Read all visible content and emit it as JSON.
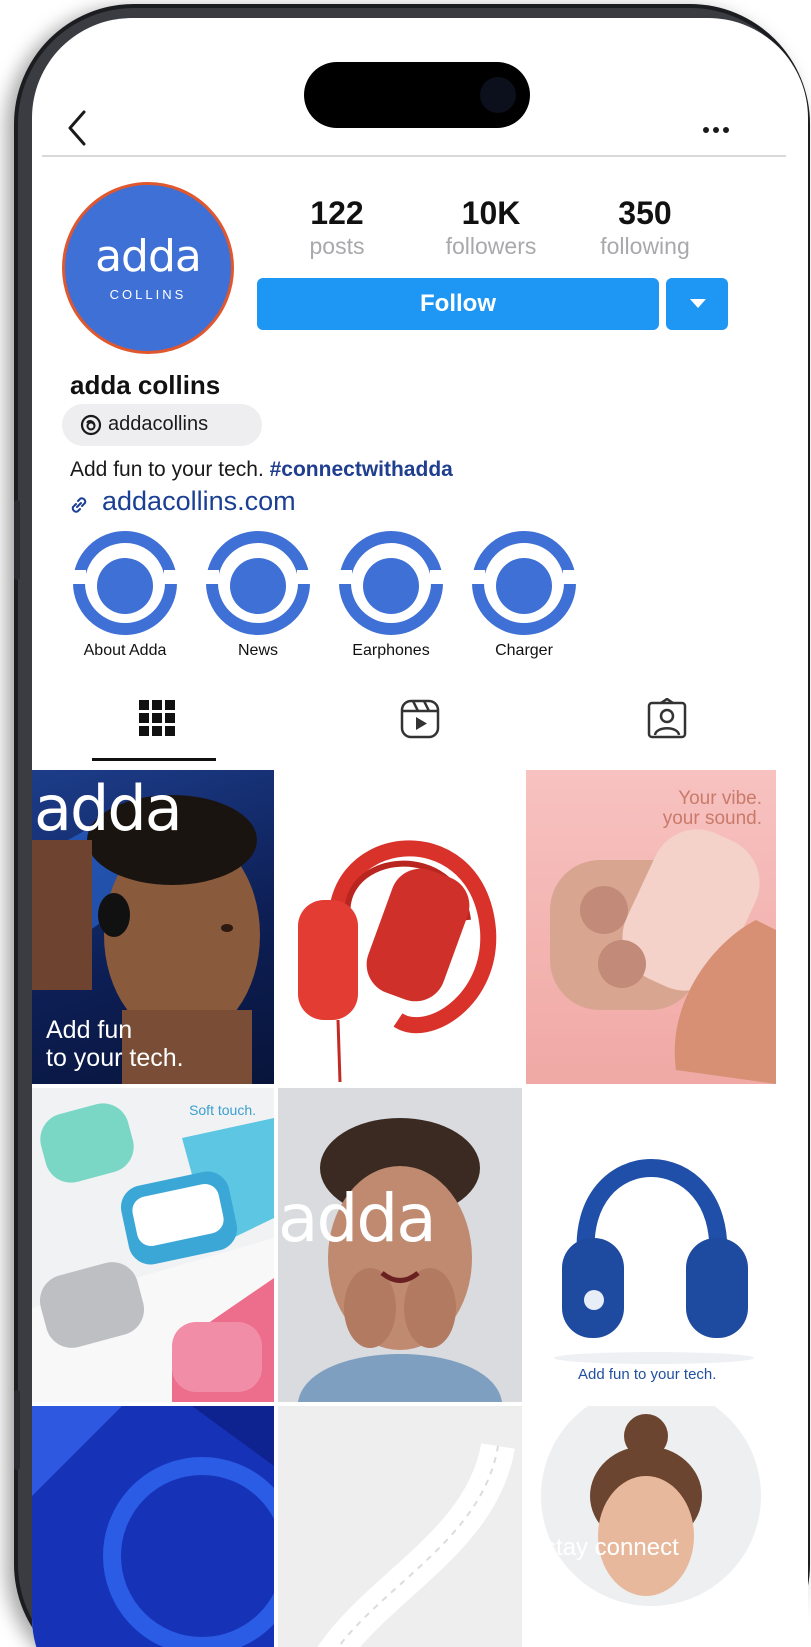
{
  "profile": {
    "posts": {
      "count": "122",
      "label": "posts"
    },
    "followers": {
      "count": "10K",
      "label": "followers"
    },
    "following": {
      "count": "350",
      "label": "following"
    },
    "follow_label": "Follow",
    "name": "adda collins",
    "threads_handle": "addacollins",
    "bio_text": "Add fun to your tech. ",
    "bio_hashtag": "#connectwithadda",
    "website": "addacollins.com",
    "avatar_logo": "adda",
    "avatar_sub": "COLLINS"
  },
  "highlights": [
    {
      "label": "About Adda"
    },
    {
      "label": "News"
    },
    {
      "label": "Earphones"
    },
    {
      "label": "Charger"
    }
  ],
  "tabs": [
    {
      "icon": "grid-icon",
      "selected": true
    },
    {
      "icon": "reels-icon",
      "selected": false
    },
    {
      "icon": "tagged-icon",
      "selected": false
    }
  ],
  "grid": [
    {
      "type": "model-earbud",
      "logo": "adda",
      "caption_line1": "Add fun",
      "caption_line2": "to your tech."
    },
    {
      "type": "red-headphones"
    },
    {
      "type": "earbuds-case",
      "caption_line1": "Your vibe.",
      "caption_line2": "your sound."
    },
    {
      "type": "airpod-cases",
      "caption": "Soft touch."
    },
    {
      "type": "woman-smiling",
      "logo": "adda"
    },
    {
      "type": "blue-headphones",
      "caption": "Add fun to your tech."
    },
    {
      "type": "blue-abstract"
    },
    {
      "type": "white-cable"
    },
    {
      "type": "woman-bun",
      "caption": "stay connect"
    }
  ],
  "colors": {
    "brand_blue": "#3f70d6",
    "follow_blue": "#1e96f4",
    "hashtag": "#1f3e8f",
    "link": "#1a3f94"
  }
}
